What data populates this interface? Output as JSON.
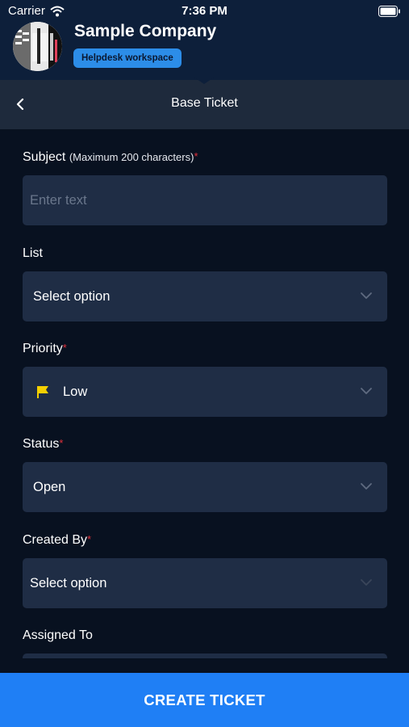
{
  "status_bar": {
    "carrier": "Carrier",
    "time": "7:36 PM"
  },
  "header": {
    "company_name": "Sample Company",
    "workspace_badge": "Helpdesk workspace"
  },
  "nav": {
    "title": "Base Ticket"
  },
  "form": {
    "subject": {
      "label": "Subject",
      "hint": "(Maximum 200 characters)",
      "required_mark": "*",
      "placeholder": "Enter text"
    },
    "list": {
      "label": "List",
      "value": "Select option"
    },
    "priority": {
      "label": "Priority",
      "required_mark": "*",
      "value": "Low",
      "flag_color": "#f5d000"
    },
    "status": {
      "label": "Status",
      "required_mark": "*",
      "value": "Open"
    },
    "created_by": {
      "label": "Created By",
      "required_mark": "*",
      "value": "Select option"
    },
    "assigned_to": {
      "label": "Assigned To"
    }
  },
  "actions": {
    "create_ticket": "CREATE TICKET"
  },
  "colors": {
    "accent": "#1f7ff5",
    "badge": "#2c8de8",
    "required": "#e0303a",
    "field_bg": "#1f2d45"
  },
  "icons": [
    "wifi-icon",
    "battery-icon",
    "back-chevron-icon",
    "chevron-down-icon",
    "flag-icon"
  ]
}
